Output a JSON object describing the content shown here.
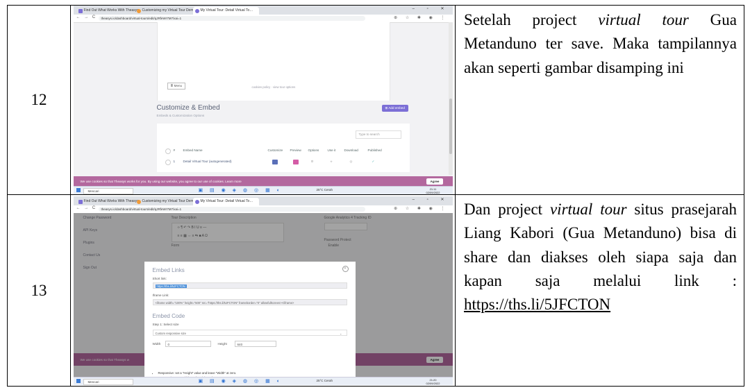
{
  "rows": [
    {
      "number": "12",
      "description_parts": [
        "Setelah project ",
        "virtual tour",
        " Gua Metanduno ter save. Maka tampilannya akan seperti gambar disamping ini"
      ],
      "screenshot": {
        "tabs": [
          "Find Out What Works With Theasys",
          "Customizing my Virtual Tour Dem…",
          "My Virtual Tour: Detail Virtual To…"
        ],
        "url": "theasys.io/dashboard/virtual-tours/edit/qJRfeWr7M7/xai=1",
        "preview_button": "≣ Menu",
        "preview_meta": "cookies policy  ·  view tour options",
        "section_title": "Customize & Embed",
        "section_subtitle": "Embeds & Customization Options",
        "add_embed": "⊞ Add embed",
        "search_placeholder": "Type to search",
        "table_headers": [
          "#",
          "Embed Name",
          "Customize",
          "Preview",
          "Options",
          "Use it",
          "Download",
          "Published"
        ],
        "table_row": [
          "1",
          "Detail Virtual Tour (autogenerated)"
        ],
        "cookie_text": "We use cookies so that Theasys works for you. By using our website, you agree to our use of cookies.  Learn more",
        "agree": "Agree",
        "taskbar_search": "Mencari",
        "weather": "25°C Cerah",
        "clock_time": "21:11",
        "clock_date": "02/09/2022"
      }
    },
    {
      "number": "13",
      "description_parts": [
        "Dan project ",
        "virtual tour",
        "  situs prasejarah Liang Kabori (Gua Metanduno) bisa di share dan diakses oleh siapa saja dan kapan saja melalui link : "
      ],
      "link": "https://ths.li/5JFCTON",
      "screenshot": {
        "tabs": [
          "Find Out What Works With Theasys",
          "Customizing my Virtual Tour Dem…",
          "My Virtual Tour: Detail Virtual To…"
        ],
        "url": "theasys.io/dashboard/virtual-tours/edit/qJRfeWr7M7/xai=1",
        "sidebar": [
          "Change Password",
          "API Keys",
          "Plugins",
          "Contact Us",
          "Sign Out"
        ],
        "tour_description": "Tour Description",
        "analytics_label": "Google Analytics 4 Tracking ID",
        "password_label": "Password Protect",
        "enable": "Enable",
        "form_label": "Form",
        "modal_title": "Embed Links",
        "short_link_label": "Short link:",
        "short_link": "https://ths.li/5JFCTON",
        "iframe_label": "Iframe Link:",
        "iframe_code": "<iframe width=\"100%\" height=\"500\" src=\"https://ths.li/5JFCTON\" frameborder=\"0\" allowfullscreen></iframe>",
        "embed_code_title": "Embed Code",
        "step_label": "Step 1: Select size",
        "size_option": "Custom responsive size",
        "width_label": "Width",
        "width_value": "0",
        "height_label": "Height",
        "height_value": "640",
        "bullet_1": "Responsive: set a \"Height\" value and leave \"Width\" at zero.",
        "bullet_2": "Custom size: set \"Width\" and \"Height\" values.",
        "cookie_text": "We use cookies so that Theasys w",
        "agree": "Agree",
        "taskbar_search": "Mencari",
        "weather": "25°C Cerah",
        "clock_time": "21:20",
        "clock_date": "02/09/2022"
      }
    }
  ],
  "colors": {
    "cookie_bar": "#b3689e",
    "accent": "#7c6fd6",
    "pink_button": "#d45ca6"
  }
}
